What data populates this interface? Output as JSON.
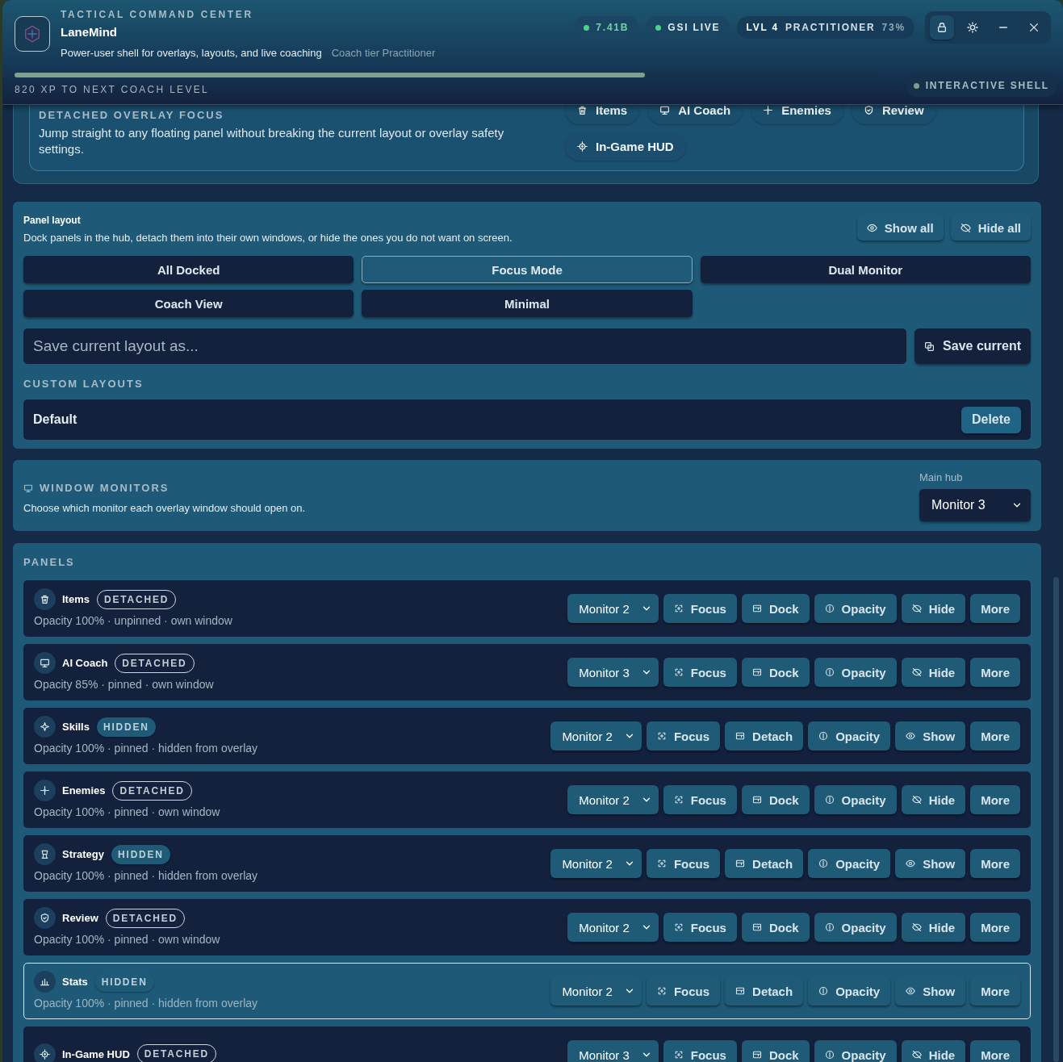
{
  "header": {
    "eyebrow": "TACTICAL COMMAND CENTER",
    "title": "LaneMind",
    "subtitle": "Power-user shell for overlays, layouts, and live coaching",
    "tier": "Coach tier Practitioner",
    "chips": [
      {
        "label": "7.41B",
        "color": "#4cd38a",
        "kind": "accent"
      },
      {
        "label": "GSI LIVE",
        "color": "#4cd38a",
        "kind": "plain"
      }
    ],
    "level_chip": {
      "level": "LVL 4",
      "rank": "PRACTITIONER",
      "percent": "73%"
    },
    "window_controls": [
      {
        "kind": "lock",
        "on": true
      },
      {
        "kind": "sun",
        "on": false
      },
      {
        "kind": "minimize",
        "on": false
      },
      {
        "kind": "close",
        "on": false
      }
    ],
    "xp_bar": {
      "level": 0.73
    },
    "xp_label": "820 XP TO NEXT COACH LEVEL",
    "mode_chip": {
      "label": "INTERACTIVE SHELL",
      "color": "#7f9f90"
    }
  },
  "overlay_focus": {
    "label": "DETACHED OVERLAY FOCUS",
    "description": "Jump straight to any floating panel without breaking the current layout or overlay safety settings.",
    "targets": [
      "Items",
      "AI Coach",
      "Enemies",
      "Review",
      "In-Game HUD"
    ]
  },
  "panel_layout": {
    "title": "Panel layout",
    "description": "Dock panels in the hub, detach them into their own windows, or hide the ones you do not want on screen.",
    "actions": [
      "Show all",
      "Hide all"
    ],
    "presets": [
      {
        "label": "All Docked",
        "selected": false
      },
      {
        "label": "Focus Mode",
        "selected": true
      },
      {
        "label": "Dual Monitor",
        "selected": false
      },
      {
        "label": "Coach View",
        "selected": false
      },
      {
        "label": "Minimal",
        "selected": false
      }
    ],
    "save_field": {
      "placeholder": "Save current layout as..."
    },
    "save_button": "Save current",
    "custom_heading": "CUSTOM LAYOUTS",
    "custom_layouts": [
      {
        "name": "Default",
        "action": "Delete"
      }
    ]
  },
  "window_monitors": {
    "label": "WINDOW MONITORS",
    "description": "Choose which monitor each overlay window should open on.",
    "main_hub": {
      "label": "Main hub",
      "value": "Monitor 3"
    }
  },
  "panels": {
    "heading": "PANELS",
    "rows": [
      {
        "name": "Items",
        "badge": "DETACHED",
        "hidden": false,
        "selected": false,
        "subtitle": "Opacity 100% · unpinned · own window",
        "monitor": "Monitor 2",
        "actions": [
          "Focus",
          "Dock",
          "Opacity",
          "Hide",
          "More"
        ]
      },
      {
        "name": "AI Coach",
        "badge": "DETACHED",
        "hidden": false,
        "selected": false,
        "subtitle": "Opacity 85% · pinned · own window",
        "monitor": "Monitor 3",
        "actions": [
          "Focus",
          "Dock",
          "Opacity",
          "Hide",
          "More"
        ]
      },
      {
        "name": "Skills",
        "badge": "HIDDEN",
        "hidden": true,
        "selected": false,
        "subtitle": "Opacity 100% · pinned · hidden from overlay",
        "monitor": "Monitor 2",
        "actions": [
          "Focus",
          "Detach",
          "Opacity",
          "Show",
          "More"
        ]
      },
      {
        "name": "Enemies",
        "badge": "DETACHED",
        "hidden": false,
        "selected": false,
        "subtitle": "Opacity 100% · pinned · own window",
        "monitor": "Monitor 2",
        "actions": [
          "Focus",
          "Dock",
          "Opacity",
          "Hide",
          "More"
        ]
      },
      {
        "name": "Strategy",
        "badge": "HIDDEN",
        "hidden": true,
        "selected": false,
        "subtitle": "Opacity 100% · pinned · hidden from overlay",
        "monitor": "Monitor 2",
        "actions": [
          "Focus",
          "Detach",
          "Opacity",
          "Show",
          "More"
        ]
      },
      {
        "name": "Review",
        "badge": "DETACHED",
        "hidden": false,
        "selected": false,
        "subtitle": "Opacity 100% · pinned · own window",
        "monitor": "Monitor 2",
        "actions": [
          "Focus",
          "Dock",
          "Opacity",
          "Hide",
          "More"
        ]
      },
      {
        "name": "Stats",
        "badge": "HIDDEN",
        "hidden": true,
        "selected": true,
        "subtitle": "Opacity 100% · pinned · hidden from overlay",
        "monitor": "Monitor 2",
        "actions": [
          "Focus",
          "Detach",
          "Opacity",
          "Show",
          "More"
        ]
      },
      {
        "name": "In-Game HUD",
        "badge": "DETACHED",
        "hidden": false,
        "selected": false,
        "monitor": "Monitor 3",
        "actions": [
          "Focus",
          "Dock",
          "Opacity",
          "Hide",
          "More"
        ]
      }
    ]
  }
}
